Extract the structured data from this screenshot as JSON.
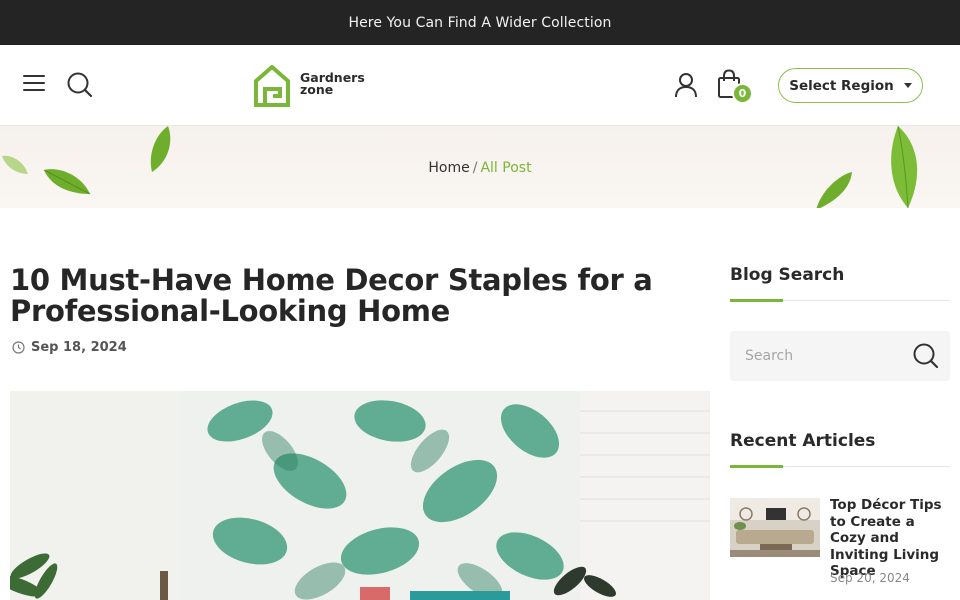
{
  "announcement": "Here You Can Find A Wider Collection",
  "header": {
    "logo_line1": "Gardners",
    "logo_line2": "zone",
    "region_label": "Select Region",
    "cart_count": "0",
    "accent_color": "#7ab637"
  },
  "breadcrumb": {
    "home": "Home",
    "separator": "/",
    "current": "All Post"
  },
  "post": {
    "title": "10 Must-Have Home Decor Staples for a Professional-Looking Home",
    "date": "Sep 18, 2024"
  },
  "sidebar": {
    "search_title": "Blog Search",
    "search_placeholder": "Search",
    "recent_title": "Recent Articles",
    "articles": [
      {
        "title": "Top Décor Tips to Create a Cozy and Inviting Living Space",
        "date": "Sep 20, 2024"
      }
    ]
  },
  "icons": [
    "menu-icon",
    "search-icon",
    "user-icon",
    "shopping-bag-icon",
    "caret-down-icon",
    "clock-icon",
    "leaf-icon"
  ]
}
